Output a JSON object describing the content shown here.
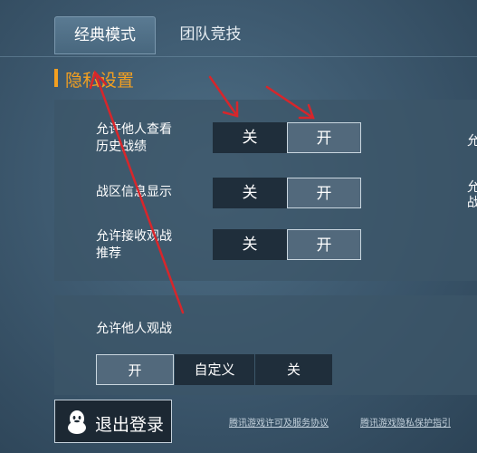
{
  "tabs": [
    {
      "label": "经典模式",
      "active": true
    },
    {
      "label": "团队竞技",
      "active": false
    }
  ],
  "section": {
    "title": "隐私设置",
    "accent_color": "#f4a020"
  },
  "settings": [
    {
      "label_line1": "允许他人查看",
      "label_line2": "历史战绩",
      "off": "关",
      "on": "开",
      "selected": "开"
    },
    {
      "label_line1": "战区信息显示",
      "label_line2": "",
      "off": "关",
      "on": "开",
      "selected": "开"
    },
    {
      "label_line1": "允许接收观战",
      "label_line2": "推荐",
      "off": "关",
      "on": "开",
      "selected": "开"
    }
  ],
  "right_edge": {
    "line1": "允",
    "line2": "允",
    "line3": "战"
  },
  "spectate": {
    "label": "允许他人观战",
    "options": [
      "开",
      "自定义",
      "关"
    ],
    "selected": "开"
  },
  "logout": {
    "label": "退出登录",
    "icon": "qq-penguin-icon"
  },
  "footer": {
    "link_terms": "腾讯游戏许可及服务协议",
    "link_privacy": "腾讯游戏隐私保护指引"
  },
  "annotation_color": "#d7262b"
}
